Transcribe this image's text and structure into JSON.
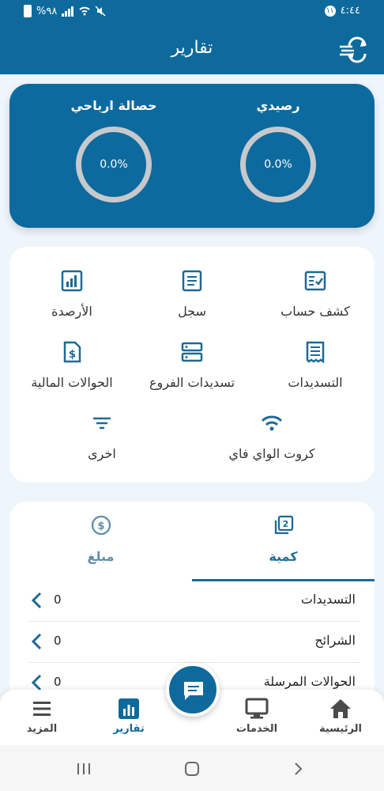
{
  "status_bar": {
    "time": "٤:٤٤",
    "notification_count": "١١",
    "battery": "%٩٨"
  },
  "header": {
    "title": "تقارير",
    "refresh_icon": "refresh-currency-icon"
  },
  "balance_card": {
    "my_balance": {
      "label": "رصيدي",
      "value": "0.0%"
    },
    "profit_share": {
      "label": "حصالة ارباحي",
      "value": "0.0%"
    }
  },
  "reports": [
    {
      "label": "كشف حساب",
      "icon": "statement-icon"
    },
    {
      "label": "سجل",
      "icon": "log-icon"
    },
    {
      "label": "الأرصدة",
      "icon": "balances-chart-icon"
    },
    {
      "label": "التسديدات",
      "icon": "receipt-icon"
    },
    {
      "label": "تسديدات الفروع",
      "icon": "server-icon"
    },
    {
      "label": "الحوالات المالية",
      "icon": "money-document-icon"
    },
    {
      "label": "كروت الواي فاي",
      "icon": "wifi-icon"
    },
    {
      "label": "اخرى",
      "icon": "filter-icon"
    }
  ],
  "stats": {
    "tabs": [
      {
        "label": "كمية",
        "icon": "quantity-icon",
        "active": true
      },
      {
        "label": "مبلغ",
        "icon": "dollar-circle-icon",
        "active": false
      }
    ],
    "rows": [
      {
        "label": "التسديدات",
        "value": "0"
      },
      {
        "label": "الشرائح",
        "value": "0"
      },
      {
        "label": "الحوالات المرسلة",
        "value": "0"
      }
    ]
  },
  "bottom_nav": [
    {
      "label": "الرئيسية",
      "icon": "home-icon"
    },
    {
      "label": "الخدمات",
      "icon": "monitor-icon"
    },
    {
      "label": "تقارير",
      "icon": "bar-chart-icon",
      "active": true
    },
    {
      "label": "المزيد",
      "icon": "menu-icon"
    }
  ],
  "colors": {
    "primary": "#0e6a9c",
    "background": "#eef5fb",
    "ring": "#c7c9cc"
  }
}
